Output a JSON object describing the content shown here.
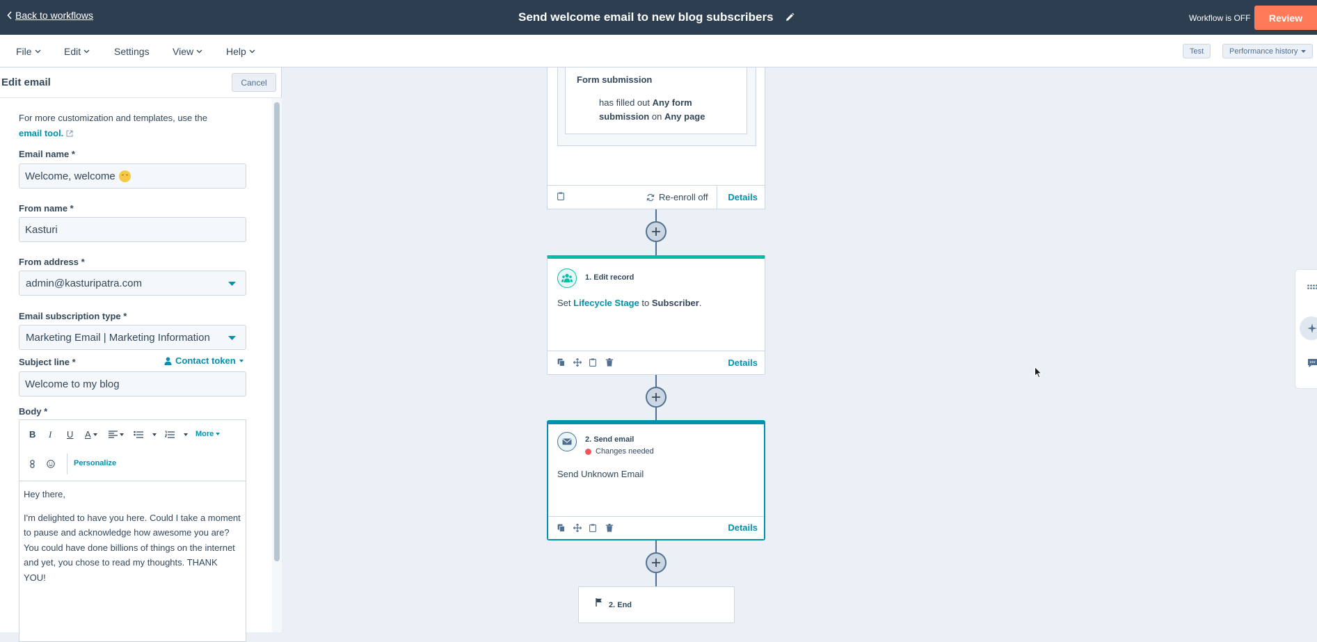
{
  "topbar": {
    "back_label": "Back to workflows",
    "title": "Send welcome email to new blog subscribers",
    "status": "Workflow is OFF",
    "review_label": "Review"
  },
  "menubar": {
    "items": [
      "File",
      "Edit",
      "Settings",
      "View",
      "Help"
    ],
    "test_label": "Test",
    "performance_label": "Performance history"
  },
  "panel": {
    "title": "Edit email",
    "cancel_label": "Cancel",
    "help_text": "For more customization and templates, use the",
    "help_link": "email tool.",
    "email_name_label": "Email name *",
    "email_name_value": "Welcome, welcome",
    "from_name_label": "From name *",
    "from_name_value": "Kasturi",
    "from_address_label": "From address *",
    "from_address_value": "admin@kasturipatra.com",
    "subscription_label": "Email subscription type *",
    "subscription_value": "Marketing Email | Marketing Information",
    "subject_label": "Subject line *",
    "contact_token_label": "Contact token",
    "subject_value": "Welcome to my blog",
    "body_label": "Body *",
    "toolbar": {
      "bold": "B",
      "italic": "I",
      "underline": "U",
      "color": "A",
      "more_label": "More",
      "personalize_label": "Personalize"
    },
    "body_paragraphs": [
      "Hey there,",
      "I'm delighted to have you here. Could I take a moment to pause and acknowledge how awesome you are? You could have done billions of things on the internet and yet, you chose to read my thoughts. THANK YOU!"
    ]
  },
  "canvas": {
    "trigger": {
      "title": "Form submission",
      "text_prefix": "has filled out",
      "text_bold1": "Any form submission",
      "text_mid": "on",
      "text_bold2": "Any page",
      "reenroll_label": "Re-enroll off",
      "details_label": "Details"
    },
    "action1": {
      "title": "1. Edit record",
      "text_prefix": "Set",
      "property": "Lifecycle Stage",
      "text_mid": "to",
      "value": "Subscriber",
      "text_suffix": ".",
      "details_label": "Details",
      "accent": "#00bda5"
    },
    "action2": {
      "title": "2. Send email",
      "status": "Changes needed",
      "text": "Send Unknown Email",
      "details_label": "Details",
      "accent": "#0091ae",
      "status_color": "#f2545b"
    },
    "end": {
      "title": "2. End"
    }
  },
  "colors": {
    "topbar": "#2d3e50",
    "review": "#ff7a59",
    "link": "#0091ae",
    "canvas": "#eaf0f6"
  }
}
